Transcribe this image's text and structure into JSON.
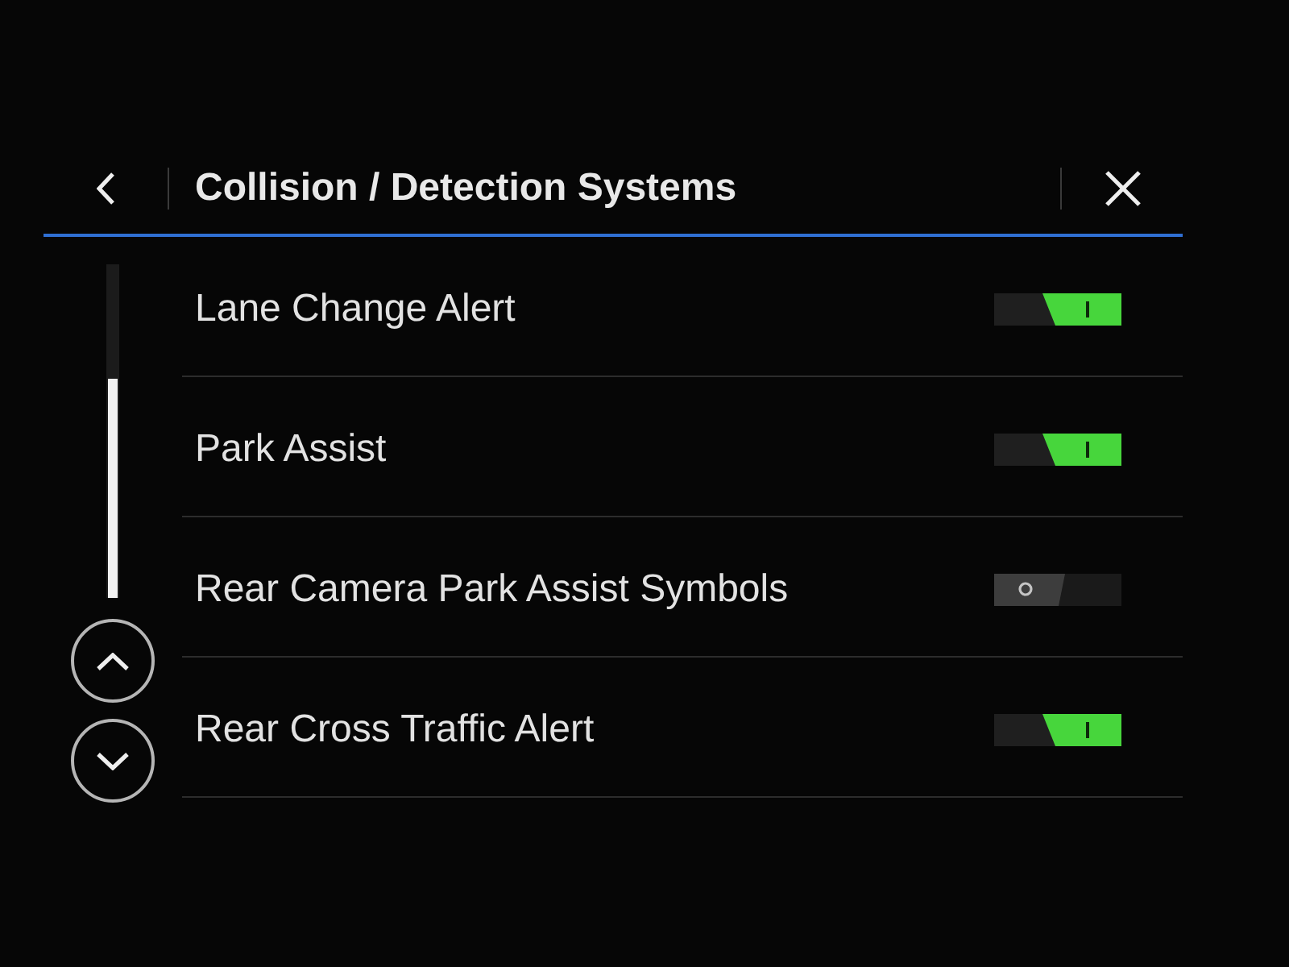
{
  "header": {
    "title": "Collision / Detection Systems"
  },
  "settings": [
    {
      "label": "Lane Change Alert",
      "on": true
    },
    {
      "label": "Park Assist",
      "on": true
    },
    {
      "label": "Rear Camera Park Assist Symbols",
      "on": false
    },
    {
      "label": "Rear Cross Traffic Alert",
      "on": true
    }
  ]
}
